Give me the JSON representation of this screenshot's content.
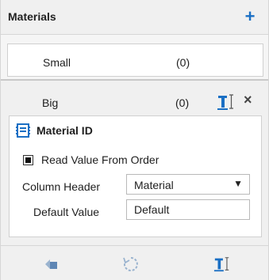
{
  "header": {
    "title": "Materials",
    "add_label": "+"
  },
  "items": [
    {
      "name": "Small",
      "count": "(0)"
    },
    {
      "name": "Big",
      "count": "(0)",
      "close_label": "×"
    }
  ],
  "detail": {
    "title": "Material ID",
    "read_value_label": "Read Value From Order",
    "read_value_checked": true,
    "column_header_label": "Column Header",
    "column_header_value": "Material",
    "default_value_label": "Default Value",
    "default_value": "Default"
  },
  "colors": {
    "accent": "#1a6fc4",
    "icon_muted": "#9ab3cf"
  },
  "icons": [
    "plus-icon",
    "text-cursor-icon",
    "close-icon",
    "calendar-icon",
    "back-icon",
    "refresh-icon"
  ]
}
